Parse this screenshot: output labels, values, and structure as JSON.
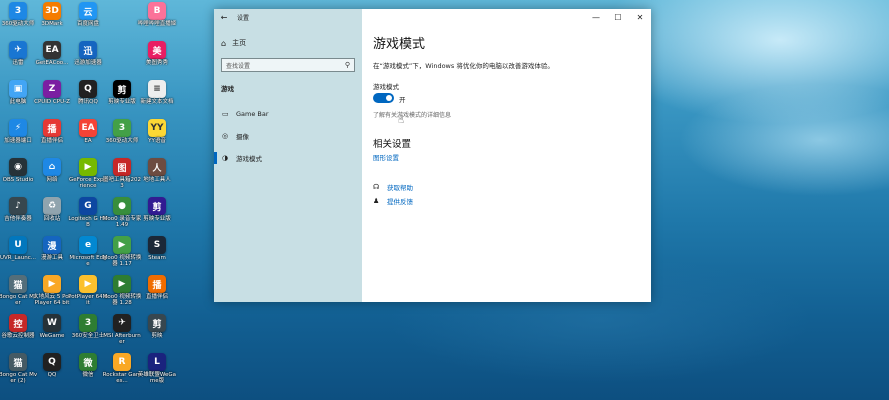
{
  "desktop": {
    "icons": [
      {
        "label": "360驱动大师",
        "color": "#1e88e5",
        "glyph": "3"
      },
      {
        "label": "3DMark",
        "color": "#f57c00",
        "glyph": "3D"
      },
      {
        "label": "百度网盘",
        "color": "#2196f3",
        "glyph": "云"
      },
      {
        "label": "",
        "color": "",
        "glyph": ""
      },
      {
        "label": "哔哩哔哩直播姬",
        "color": "#fb7299",
        "glyph": "B"
      },
      {
        "label": "迅雷",
        "color": "#1976d2",
        "glyph": "✈"
      },
      {
        "label": "GetEACoo...",
        "color": "#333333",
        "glyph": "EA"
      },
      {
        "label": "迅游加速器",
        "color": "#1565c0",
        "glyph": "迅"
      },
      {
        "label": "",
        "color": "",
        "glyph": ""
      },
      {
        "label": "美图秀秀",
        "color": "#e91e63",
        "glyph": "美"
      },
      {
        "label": "此电脑",
        "color": "#42a5f5",
        "glyph": "▣"
      },
      {
        "label": "CPUID CPU-Z",
        "color": "#7b1fa2",
        "glyph": "Z"
      },
      {
        "label": "腾讯QQ",
        "color": "#212121",
        "glyph": "Q"
      },
      {
        "label": "剪映专业版",
        "color": "#000000",
        "glyph": "剪"
      },
      {
        "label": "新建文本文档",
        "color": "#eeeeee",
        "glyph": "≡"
      },
      {
        "label": "加速器端口",
        "color": "#1e88e5",
        "glyph": "⚡"
      },
      {
        "label": "直播伴侣",
        "color": "#e53935",
        "glyph": "播"
      },
      {
        "label": "EA",
        "color": "#f44336",
        "glyph": "EA"
      },
      {
        "label": "360驱动大师",
        "color": "#43a047",
        "glyph": "3"
      },
      {
        "label": "YY语音",
        "color": "#fdd835",
        "glyph": "YY"
      },
      {
        "label": "OBS Studio",
        "color": "#263238",
        "glyph": "◉"
      },
      {
        "label": "网络",
        "color": "#1e88e5",
        "glyph": "⌂"
      },
      {
        "label": "GeForce Experience",
        "color": "#76b900",
        "glyph": "▶"
      },
      {
        "label": "图吧工具箱2023",
        "color": "#c62828",
        "glyph": "图"
      },
      {
        "label": "地地工具人",
        "color": "#6d4c41",
        "glyph": "人"
      },
      {
        "label": "吉他伴奏器",
        "color": "#37474f",
        "glyph": "♪"
      },
      {
        "label": "回收站",
        "color": "#90a4ae",
        "glyph": "♻"
      },
      {
        "label": "Logitech G HUB",
        "color": "#0d47a1",
        "glyph": "G"
      },
      {
        "label": "Moo0 录音专家 1.49",
        "color": "#388e3c",
        "glyph": "●"
      },
      {
        "label": "剪映专业版",
        "color": "#311b92",
        "glyph": "剪"
      },
      {
        "label": "UVR_Launc...",
        "color": "#0277bd",
        "glyph": "U"
      },
      {
        "label": "漫游工具",
        "color": "#1565c0",
        "glyph": "漫"
      },
      {
        "label": "Microsoft Edge",
        "color": "#0288d1",
        "glyph": "e"
      },
      {
        "label": "Moo0 视频转换器 1.17",
        "color": "#43a047",
        "glyph": "▶"
      },
      {
        "label": "Steam",
        "color": "#1b2838",
        "glyph": "S"
      },
      {
        "label": "Bongo Cat Mver",
        "color": "#546e7a",
        "glyph": "猫"
      },
      {
        "label": "大地风云 5 PotPlayer 64 bit",
        "color": "#f9a825",
        "glyph": "▶"
      },
      {
        "label": "PotPlayer 64 bit",
        "color": "#fbc02d",
        "glyph": "▶"
      },
      {
        "label": "Moo0 视频转换器 1.28",
        "color": "#2e7d32",
        "glyph": "▶"
      },
      {
        "label": "直播伴侣",
        "color": "#ef6c00",
        "glyph": "播"
      },
      {
        "label": "谷歌云控制器",
        "color": "#c62828",
        "glyph": "控"
      },
      {
        "label": "WeGame",
        "color": "#263238",
        "glyph": "W"
      },
      {
        "label": "360安全卫士",
        "color": "#2e7d32",
        "glyph": "3"
      },
      {
        "label": "MSI Afterburner",
        "color": "#212121",
        "glyph": "✈"
      },
      {
        "label": "剪映",
        "color": "#37474f",
        "glyph": "剪"
      },
      {
        "label": "Bongo Cat Mver (2)",
        "color": "#455a64",
        "glyph": "猫"
      },
      {
        "label": "QQ",
        "color": "#212121",
        "glyph": "Q"
      },
      {
        "label": "微信",
        "color": "#2e7d32",
        "glyph": "微"
      },
      {
        "label": "Rockstar Games...",
        "color": "#f9a825",
        "glyph": "R"
      },
      {
        "label": "英雄联盟WeGame版",
        "color": "#1a237e",
        "glyph": "L"
      }
    ]
  },
  "window": {
    "title": "设置",
    "back_icon": "←",
    "minimize": "—",
    "maximize": "☐",
    "close": "✕",
    "sidebar": {
      "home_label": "主页",
      "search_placeholder": "查找设置",
      "section": "游戏",
      "items": [
        {
          "label": "Game Bar",
          "icon": "▭"
        },
        {
          "label": "摄像",
          "icon": "◎"
        },
        {
          "label": "游戏模式",
          "icon": "◑"
        }
      ]
    },
    "main": {
      "title": "游戏模式",
      "description": "在“游戏模式”下，Windows 将优化你的电脑以改善游戏体验。",
      "toggle_title": "游戏模式",
      "toggle_state": "开",
      "toggle_on": true,
      "learn_more": "了解有关游戏模式的详细信息",
      "related_title": "相关设置",
      "graphics_link": "图形设置",
      "help_link": "获取帮助",
      "feedback_link": "提供反馈"
    }
  },
  "colors": {
    "accent": "#0067c0",
    "sidebar_bg": "#c8dfe4"
  }
}
